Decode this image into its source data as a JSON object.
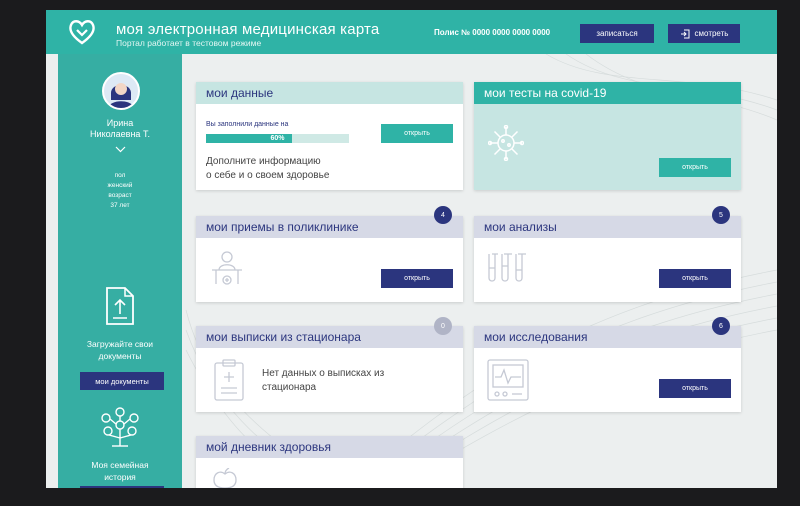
{
  "header": {
    "title": "моя электронная медицинская карта",
    "subtitle": "Портал работает в тестовом режиме",
    "polis": "Полис № 0000 0000 0000 0000",
    "signup_label": "записаться",
    "view_label": "смотреть"
  },
  "profile": {
    "first_name": "Ирина",
    "patronymic_initial": "Николаевна Т.",
    "sex_label": "пол",
    "sex_value": "женский",
    "age_label": "возраст",
    "age_value": "37 лет"
  },
  "sidebar": {
    "upload_text_1": "Загружайте свои",
    "upload_text_2": "документы",
    "docs_button": "мои документы",
    "family_text_1": "Моя семейная",
    "family_text_2": "история"
  },
  "cards": {
    "my_data": {
      "title": "мои данные",
      "filled_label": "Вы заполнили данные на",
      "progress_label": "60%",
      "progress": 0.6,
      "hint_1": "Дополните информацию",
      "hint_2": "о себе и о своем здоровье",
      "button": "открыть"
    },
    "covid": {
      "title": "мои тесты на covid-19",
      "button": "открыть"
    },
    "appointments": {
      "title": "мои приемы в поликлинике",
      "count": "4",
      "button": "открыть"
    },
    "analyses": {
      "title": "мои анализы",
      "count": "5",
      "button": "открыть"
    },
    "discharges": {
      "title": "мои выписки из стационара",
      "count": "0",
      "empty_1": "Нет данных о выписках из",
      "empty_2": "стационара"
    },
    "research": {
      "title": "мои исследования",
      "count": "6",
      "button": "открыть"
    },
    "diary": {
      "title": "мой дневник здоровья"
    }
  },
  "colors": {
    "teal": "#2fb3a6",
    "navy": "#2b357e",
    "sidebar": "#36aea3",
    "light_teal_head": "#c6e5e2",
    "gray_head": "#d6d9e6"
  }
}
